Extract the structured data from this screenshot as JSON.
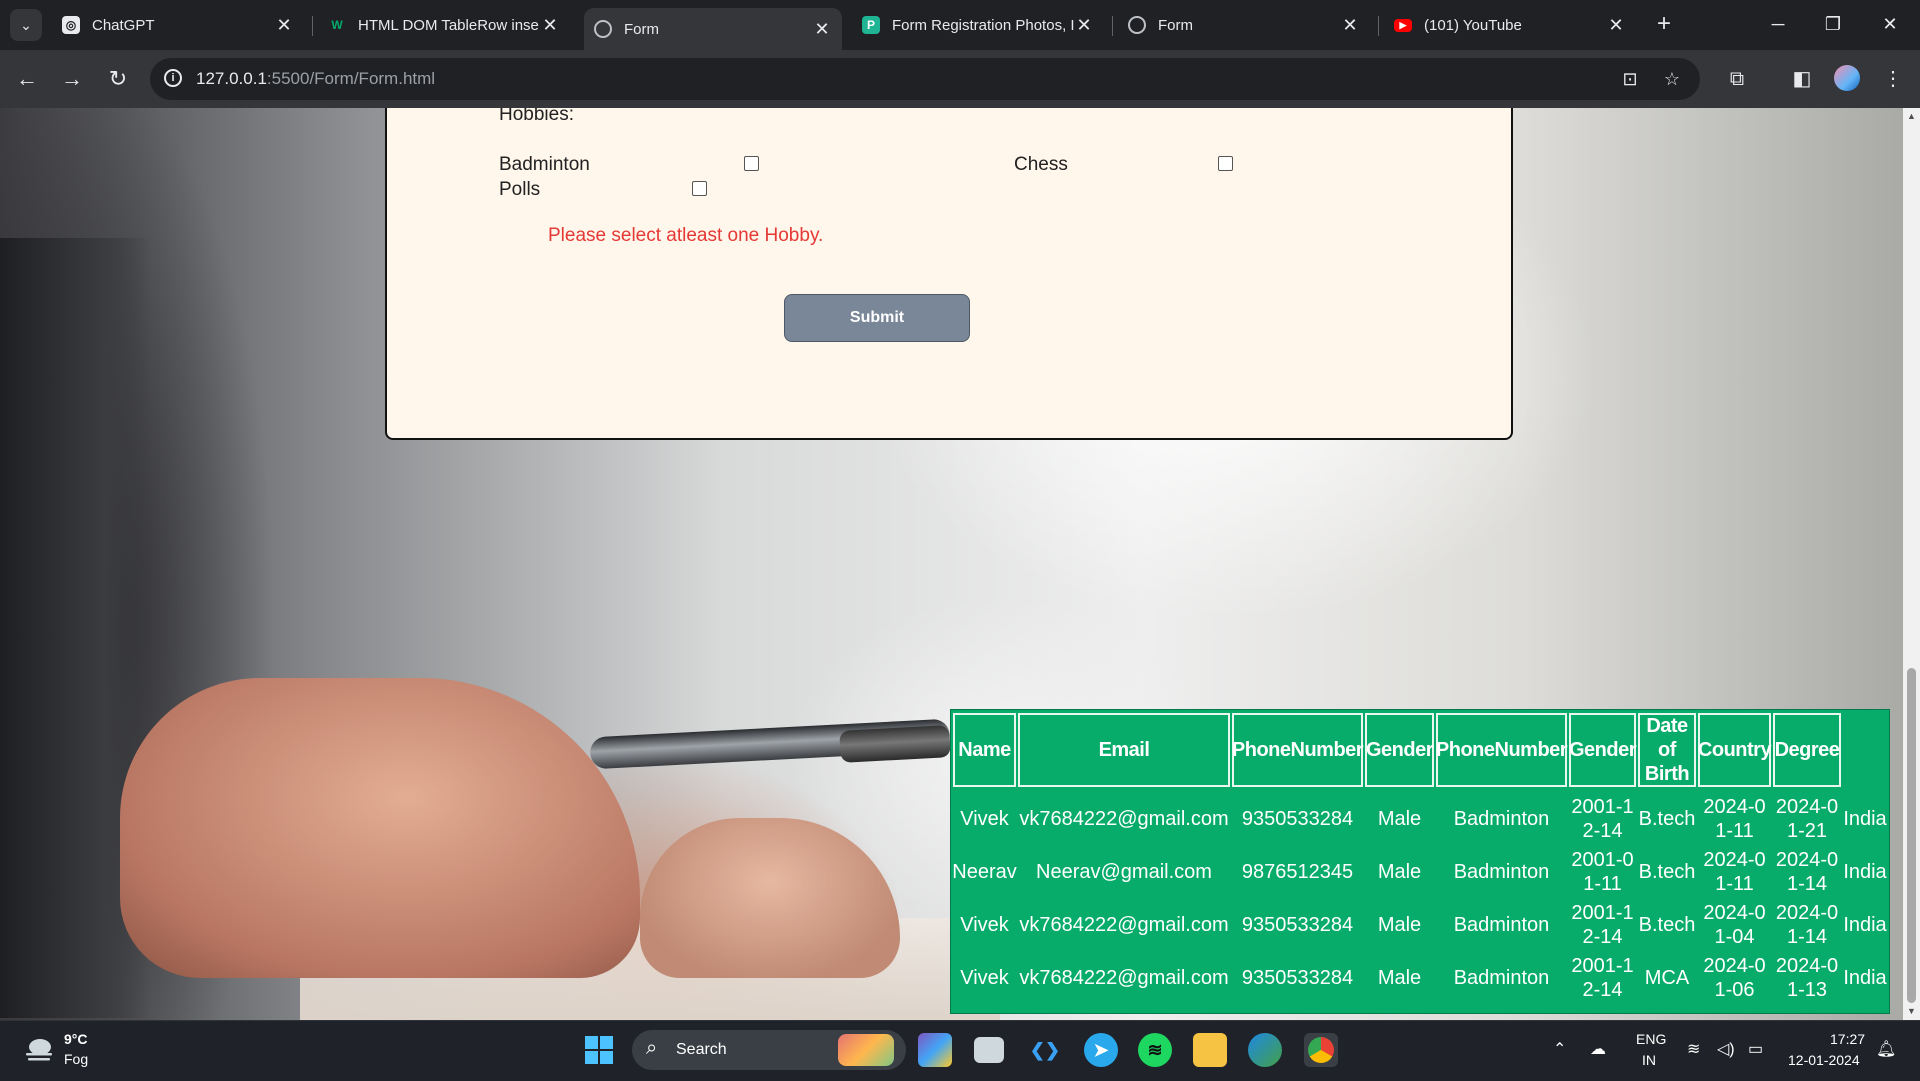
{
  "browser": {
    "tabs": [
      {
        "title": "ChatGPT",
        "icon": "chatgpt-icon",
        "active": false
      },
      {
        "title": "HTML DOM TableRow inse",
        "icon": "w3schools-icon",
        "active": false
      },
      {
        "title": "Form",
        "icon": "globe-icon",
        "active": true
      },
      {
        "title": "Form Registration Photos, I",
        "icon": "freepik-icon",
        "active": false
      },
      {
        "title": "Form",
        "icon": "globe-icon",
        "active": false
      },
      {
        "title": "(101) YouTube",
        "icon": "youtube-icon",
        "active": false
      }
    ],
    "url_host": "127.0.0.1",
    "url_rest": ":5500/Form/Form.html"
  },
  "form": {
    "hobbies_label": "Hobbies:",
    "hobby_options": [
      "Badminton",
      "Chess",
      "Polls"
    ],
    "error_text": "Please select atleast one Hobby.",
    "submit_label": "Submit"
  },
  "table": {
    "headers": [
      "Name",
      "Email",
      "PhoneNumber",
      "Gender",
      "PhoneNumber",
      "Gender",
      "Date of Birth",
      "Country",
      "Degree"
    ],
    "rows": [
      [
        "Vivek",
        "vk7684222@gmail.com",
        "9350533284",
        "Male",
        "Badminton",
        "2001-12-14",
        "B.tech",
        "2024-01-11",
        "2024-01-21",
        "India"
      ],
      [
        "Neerav",
        "Neerav@gmail.com",
        "9876512345",
        "Male",
        "Badminton",
        "2001-01-11",
        "B.tech",
        "2024-01-11",
        "2024-01-14",
        "India"
      ],
      [
        "Vivek",
        "vk7684222@gmail.com",
        "9350533284",
        "Male",
        "Badminton",
        "2001-12-14",
        "B.tech",
        "2024-01-04",
        "2024-01-14",
        "India"
      ],
      [
        "Vivek",
        "vk7684222@gmail.com",
        "9350533284",
        "Male",
        "Badminton",
        "2001-12-14",
        "MCA",
        "2024-01-06",
        "2024-01-13",
        "India"
      ]
    ]
  },
  "taskbar": {
    "temp": "9°C",
    "weather": "Fog",
    "search_label": "Search",
    "lang": "ENG",
    "region": "IN",
    "time": "17:27",
    "date": "12-01-2024"
  },
  "colors": {
    "table_bg": "#08ac6a",
    "form_bg": "#fff6ec",
    "error": "#e53935",
    "submit_bg": "#7a8798"
  }
}
